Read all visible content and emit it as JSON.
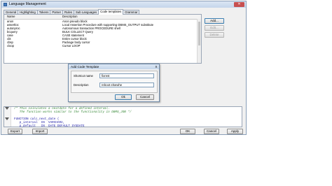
{
  "window": {
    "title": "Language Management"
  },
  "tabs": [
    "General",
    "Highlighting",
    "Tokens",
    "Parser",
    "Rules",
    "Sub Languages",
    "Code templates",
    "Grammar"
  ],
  "active_tab": 6,
  "table": {
    "headers": [
      "Name",
      "Description"
    ],
    "rows": [
      {
        "name": "anon",
        "desc": "Anon pseudo block"
      },
      {
        "name": "assertloc",
        "desc": "Local Assertion Procedure with supporting DBMS_OUTPUT substitute"
      },
      {
        "name": "autonproc",
        "desc": "Autonomous transaction PROCEDURE shell"
      },
      {
        "name": "bcquery",
        "desc": "BULK COLLECT Query"
      },
      {
        "name": "case",
        "desc": "CASE statement"
      },
      {
        "name": "cbt",
        "desc": "Entire cursor block"
      },
      {
        "name": "cbsp",
        "desc": "Package body cursor"
      },
      {
        "name": "cloop",
        "desc": "Cursor LOOP"
      }
    ]
  },
  "side_buttons": {
    "add": "Add...",
    "edit": "Edit...",
    "delete": "Delete"
  },
  "dialog": {
    "title": "Add Code Template",
    "close": "X",
    "shortcut_label": "Shortcut name",
    "shortcut_value": "fixrest",
    "description_label": "Description",
    "description_value": "reboot elsewhe",
    "ok": "Ok",
    "cancel": "Cancel"
  },
  "code": {
    "line1": "/* This calculates a nextdate for a defined interval.",
    "line2": "   The function works similar to the functionality in DBMS_JOB */",
    "line3": "FUNCTION calc_next_date (",
    "line4": "   p_interval  IN  VARCHAR2,",
    "line5": "   p_default   IN  DATE DEFAULT SYSDATE"
  },
  "bottom_buttons": {
    "export": "Export",
    "import": "Import",
    "ok": "OK",
    "cancel": "Cancel",
    "apply": "Apply"
  },
  "colors": {
    "comment": "#3a8a3a",
    "keyword": "#1a1aa6",
    "title_bar": "#c4d5ea",
    "close_button": "#c75050"
  }
}
